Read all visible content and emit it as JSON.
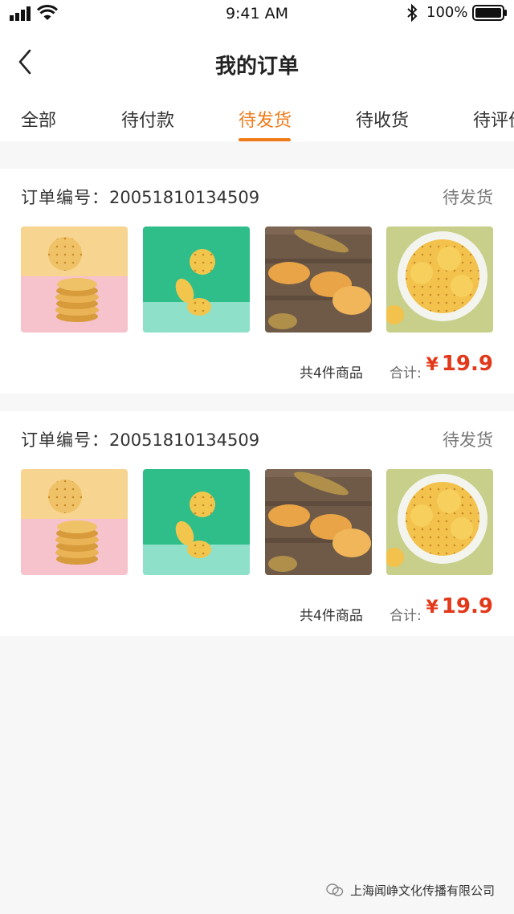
{
  "status_bar": {
    "time": "9:41 AM",
    "battery": "100%"
  },
  "nav": {
    "title": "我的订单",
    "back_icon": "chevron-left-icon"
  },
  "tabs": [
    {
      "label": "全部",
      "active": false
    },
    {
      "label": "待付款",
      "active": false
    },
    {
      "label": "待发货",
      "active": true
    },
    {
      "label": "待收货",
      "active": false
    },
    {
      "label": "待评价",
      "active": false
    }
  ],
  "colors": {
    "accent": "#f07b1a",
    "price": "#e2391b",
    "background": "#f7f7f7"
  },
  "orders": [
    {
      "number_label": "订单编号：",
      "number": "20051810134509",
      "status": "待发货",
      "item_count": "共4件商品",
      "total_label": "合计:",
      "currency": "¥",
      "total": "19.9",
      "images": [
        "cracker-stack-photo",
        "falling-crackers-photo",
        "oval-biscuits-photo",
        "cracker-bowl-photo"
      ]
    },
    {
      "number_label": "订单编号：",
      "number": "20051810134509",
      "status": "待发货",
      "item_count": "共4件商品",
      "total_label": "合计:",
      "currency": "¥",
      "total": "19.9",
      "images": [
        "cracker-stack-photo",
        "falling-crackers-photo",
        "oval-biscuits-photo",
        "cracker-bowl-photo"
      ]
    }
  ],
  "watermark": "上海闻峥文化传播有限公司"
}
